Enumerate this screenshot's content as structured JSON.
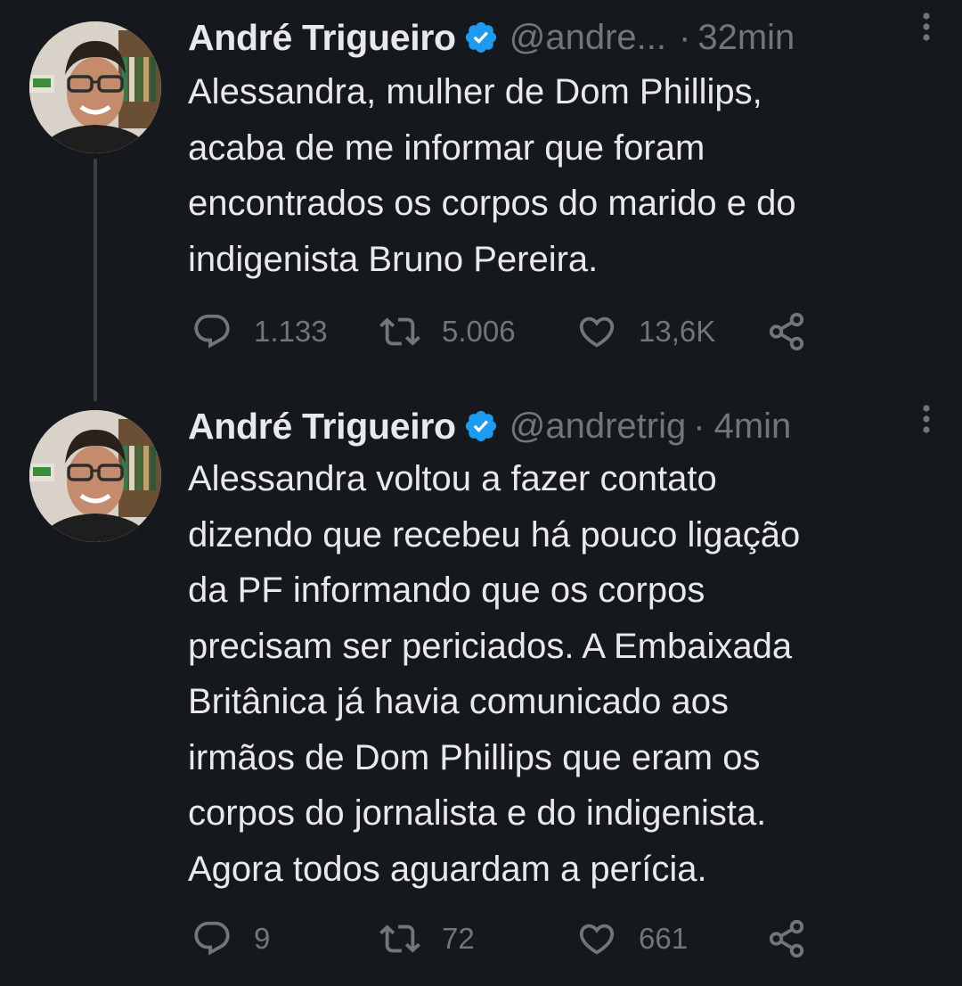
{
  "colors": {
    "background": "#15181c",
    "text_primary": "#e7e9ea",
    "text_secondary": "#71767b",
    "verified_blue": "#1d9bf0",
    "thread_line": "#3a3f45"
  },
  "tweets": [
    {
      "author": {
        "display_name": "André Trigueiro",
        "handle": "@andre...",
        "verified_icon": "verified-badge-icon"
      },
      "separator": "·",
      "time": "32min",
      "text": "Alessandra, mulher de Dom Phillips,\nacaba de me informar que foram\nencontrados os corpos do marido e do\nindigenista Bruno Pereira.",
      "stats": {
        "replies": "1.133",
        "retweets": "5.006",
        "likes": "13,6K"
      }
    },
    {
      "author": {
        "display_name": "André Trigueiro",
        "handle": "@andretrig",
        "verified_icon": "verified-badge-icon"
      },
      "separator": "·",
      "time": "4min",
      "text": "Alessandra voltou a fazer contato\ndizendo que recebeu há pouco ligação\nda PF informando que os corpos\nprecisam ser periciados. A Embaixada\nBritânica já havia comunicado aos\nirmãos de Dom Phillips que eram os\ncorpos do jornalista e do indigenista.\nAgora todos aguardam a perícia.",
      "stats": {
        "replies": "9",
        "retweets": "72",
        "likes": "661"
      }
    }
  ],
  "icons": {
    "reply": "reply-icon",
    "retweet": "retweet-icon",
    "like": "heart-icon",
    "share": "share-icon",
    "more": "more-options-icon"
  }
}
